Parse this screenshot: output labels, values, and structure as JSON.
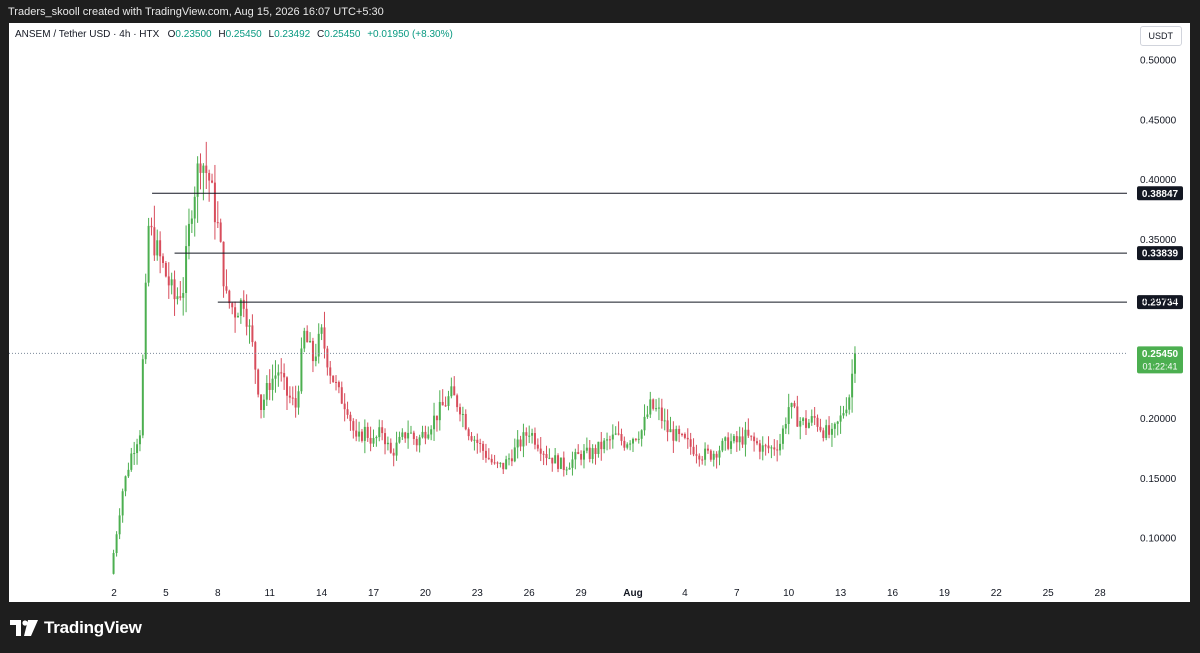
{
  "caption": "Traders_skooll created with TradingView.com, Aug 15, 2026 16:07 UTC+5:30",
  "header": {
    "symbol": "ANSEM / Tether USD · 4h · HTX",
    "o_label": "O",
    "o": "0.23500",
    "h_label": "H",
    "h": "0.25450",
    "l_label": "L",
    "l": "0.23492",
    "c_label": "C",
    "c": "0.25450",
    "change": "+0.01950 (+8.30%)"
  },
  "currency": "USDT",
  "footer": {
    "brand": "TradingView",
    "logo_icon": "tradingview-logo-icon"
  },
  "colors": {
    "up": "#4caf50",
    "down": "#d84d5c",
    "line": "#131722",
    "price_tag": "#4caf50"
  },
  "chart_data": {
    "type": "candlestick",
    "interval": "4h",
    "ylim": [
      0.065,
      0.52
    ],
    "y_ticks": [
      "0.50000",
      "0.45000",
      "0.40000",
      "0.35000",
      "0.30000",
      "0.20000",
      "0.15000",
      "0.10000"
    ],
    "x_ticks": [
      "2",
      "5",
      "8",
      "11",
      "14",
      "17",
      "20",
      "23",
      "26",
      "29",
      "Aug",
      "4",
      "7",
      "10",
      "13",
      "16",
      "19",
      "22",
      "25",
      "28"
    ],
    "horizontal_levels": [
      {
        "label": "0.38847",
        "value": 0.38847,
        "from_day": 4.2
      },
      {
        "label": "0.33839",
        "value": 0.33839,
        "from_day": 5.5
      },
      {
        "label": "0.29734",
        "value": 0.29734,
        "from_day": 8.0
      }
    ],
    "last_price": {
      "label": "0.25450",
      "value": 0.2545,
      "countdown": "01:22:41"
    },
    "daily_closes": [
      {
        "day": 1.8,
        "close": 0.07
      },
      {
        "day": 2.5,
        "close": 0.14
      },
      {
        "day": 3.0,
        "close": 0.17
      },
      {
        "day": 3.5,
        "close": 0.19
      },
      {
        "day": 4.0,
        "close": 0.36
      },
      {
        "day": 4.5,
        "close": 0.34
      },
      {
        "day": 5.0,
        "close": 0.32
      },
      {
        "day": 5.5,
        "close": 0.3
      },
      {
        "day": 6.0,
        "close": 0.31
      },
      {
        "day": 6.5,
        "close": 0.38
      },
      {
        "day": 7.0,
        "close": 0.42
      },
      {
        "day": 7.5,
        "close": 0.4
      },
      {
        "day": 8.0,
        "close": 0.36
      },
      {
        "day": 8.5,
        "close": 0.3
      },
      {
        "day": 9.0,
        "close": 0.29
      },
      {
        "day": 9.5,
        "close": 0.3
      },
      {
        "day": 10.0,
        "close": 0.26
      },
      {
        "day": 10.5,
        "close": 0.21
      },
      {
        "day": 11.0,
        "close": 0.23
      },
      {
        "day": 11.5,
        "close": 0.24
      },
      {
        "day": 12.0,
        "close": 0.22
      },
      {
        "day": 12.5,
        "close": 0.21
      },
      {
        "day": 13.0,
        "close": 0.27
      },
      {
        "day": 13.5,
        "close": 0.25
      },
      {
        "day": 14.0,
        "close": 0.27
      },
      {
        "day": 14.5,
        "close": 0.24
      },
      {
        "day": 15.0,
        "close": 0.22
      },
      {
        "day": 15.5,
        "close": 0.21
      },
      {
        "day": 16.0,
        "close": 0.18
      },
      {
        "day": 16.5,
        "close": 0.19
      },
      {
        "day": 17.0,
        "close": 0.18
      },
      {
        "day": 17.5,
        "close": 0.19
      },
      {
        "day": 18.0,
        "close": 0.17
      },
      {
        "day": 18.5,
        "close": 0.18
      },
      {
        "day": 19.0,
        "close": 0.19
      },
      {
        "day": 19.5,
        "close": 0.18
      },
      {
        "day": 20.0,
        "close": 0.19
      },
      {
        "day": 20.5,
        "close": 0.2
      },
      {
        "day": 21.0,
        "close": 0.21
      },
      {
        "day": 21.5,
        "close": 0.22
      },
      {
        "day": 22.0,
        "close": 0.21
      },
      {
        "day": 22.5,
        "close": 0.19
      },
      {
        "day": 23.0,
        "close": 0.18
      },
      {
        "day": 23.5,
        "close": 0.17
      },
      {
        "day": 24.0,
        "close": 0.16
      },
      {
        "day": 24.5,
        "close": 0.16
      },
      {
        "day": 25.0,
        "close": 0.17
      },
      {
        "day": 25.5,
        "close": 0.18
      },
      {
        "day": 26.0,
        "close": 0.19
      },
      {
        "day": 26.5,
        "close": 0.18
      },
      {
        "day": 27.0,
        "close": 0.17
      },
      {
        "day": 27.5,
        "close": 0.165
      },
      {
        "day": 28.0,
        "close": 0.16
      },
      {
        "day": 28.5,
        "close": 0.165
      },
      {
        "day": 29.0,
        "close": 0.17
      },
      {
        "day": 29.5,
        "close": 0.17
      },
      {
        "day": 30.0,
        "close": 0.175
      },
      {
        "day": 30.5,
        "close": 0.18
      },
      {
        "day": 31.0,
        "close": 0.185
      },
      {
        "day": 31.5,
        "close": 0.18
      },
      {
        "day": 32.0,
        "close": 0.185
      },
      {
        "day": 32.5,
        "close": 0.19
      },
      {
        "day": 33.0,
        "close": 0.21
      },
      {
        "day": 33.5,
        "close": 0.205
      },
      {
        "day": 34.0,
        "close": 0.19
      },
      {
        "day": 34.5,
        "close": 0.185
      },
      {
        "day": 35.0,
        "close": 0.18
      },
      {
        "day": 35.5,
        "close": 0.175
      },
      {
        "day": 36.0,
        "close": 0.17
      },
      {
        "day": 36.5,
        "close": 0.17
      },
      {
        "day": 37.0,
        "close": 0.175
      },
      {
        "day": 37.5,
        "close": 0.18
      },
      {
        "day": 38.0,
        "close": 0.18
      },
      {
        "day": 38.5,
        "close": 0.185
      },
      {
        "day": 39.0,
        "close": 0.18
      },
      {
        "day": 39.5,
        "close": 0.175
      },
      {
        "day": 40.0,
        "close": 0.175
      },
      {
        "day": 40.5,
        "close": 0.18
      },
      {
        "day": 41.0,
        "close": 0.21
      },
      {
        "day": 41.5,
        "close": 0.2
      },
      {
        "day": 42.0,
        "close": 0.195
      },
      {
        "day": 42.5,
        "close": 0.2
      },
      {
        "day": 43.0,
        "close": 0.19
      },
      {
        "day": 43.5,
        "close": 0.185
      },
      {
        "day": 44.0,
        "close": 0.2
      },
      {
        "day": 44.5,
        "close": 0.22
      },
      {
        "day": 44.83,
        "close": 0.2545
      }
    ]
  }
}
